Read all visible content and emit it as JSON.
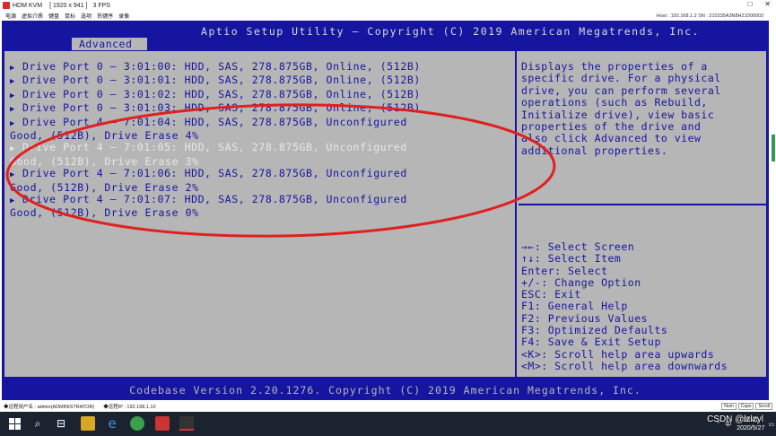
{
  "window": {
    "title": "HDM KVM",
    "resolution": "[ 1920 x 941 ]",
    "fps": "3 FPS",
    "menu": [
      "电源",
      "虚拟介质",
      "键盘",
      "鼠标",
      "选项",
      "热键序",
      "录像"
    ],
    "host_info": "Host : 192.168.1.2    SN : 210235A3N8H21000003"
  },
  "bios": {
    "title": "Aptio Setup Utility – Copyright (C) 2019 American Megatrends, Inc.",
    "active_tab": "Advanced",
    "drives": [
      {
        "line1": "Drive Port 0 – 3:01:00: HDD, SAS, 278.875GB, Online, (512B)",
        "line2": "",
        "selected": false
      },
      {
        "line1": "Drive Port 0 – 3:01:01: HDD, SAS, 278.875GB, Online, (512B)",
        "line2": "",
        "selected": false
      },
      {
        "line1": "Drive Port 0 – 3:01:02: HDD, SAS, 278.875GB, Online, (512B)",
        "line2": "",
        "selected": false
      },
      {
        "line1": "Drive Port 0 – 3:01:03: HDD, SAS, 278.875GB, Online, (512B)",
        "line2": "",
        "selected": false
      },
      {
        "line1": "Drive Port 4 – 7:01:04: HDD, SAS, 278.875GB, Unconfigured",
        "line2": "Good, (512B), Drive Erase 4%",
        "selected": false
      },
      {
        "line1": "Drive Port 4 – 7:01:05: HDD, SAS, 278.875GB, Unconfigured",
        "line2": "Good, (512B), Drive Erase 3%",
        "selected": true
      },
      {
        "line1": "Drive Port 4 – 7:01:06: HDD, SAS, 278.875GB, Unconfigured",
        "line2": "Good, (512B), Drive Erase 2%",
        "selected": false
      },
      {
        "line1": "Drive Port 4 – 7:01:07: HDD, SAS, 278.875GB, Unconfigured",
        "line2": "Good, (512B), Drive Erase 0%",
        "selected": false
      }
    ],
    "help_text": "Displays the properties of a\nspecific drive. For a physical\ndrive, you can perform several\noperations (such as Rebuild,\nInitialize drive), view basic\nproperties of the drive and\nalso click Advanced to view\nadditional properties.",
    "keys": [
      "→←: Select Screen",
      "↑↓: Select Item",
      "Enter: Select",
      "+/-: Change Option",
      "ESC: Exit",
      "F1: General Help",
      "F2: Previous Values",
      "F3: Optimized Defaults",
      "F4: Save & Exit Setup",
      "<K>: Scroll help area upwards",
      "<M>: Scroll help area downwards"
    ],
    "footer": "Codebase Version 2.20.1276. Copyright (C) 2019 American Megatrends, Inc."
  },
  "kvm_status": {
    "user": "◆远程用户名 : admin(ADMINISTRATOR)",
    "ip": "◆远程IP : 192.168.1.10",
    "buttons": [
      "Num",
      "Caps",
      "Scroll"
    ]
  },
  "taskbar": {
    "ime": "中",
    "time": "20:41",
    "date": "2020/5/27",
    "watermark": "CSDN @lzlzyl"
  },
  "colors": {
    "bios_blue": "#1515a0",
    "bios_gray": "#b6b6b6",
    "annotation_red": "#e02020"
  }
}
